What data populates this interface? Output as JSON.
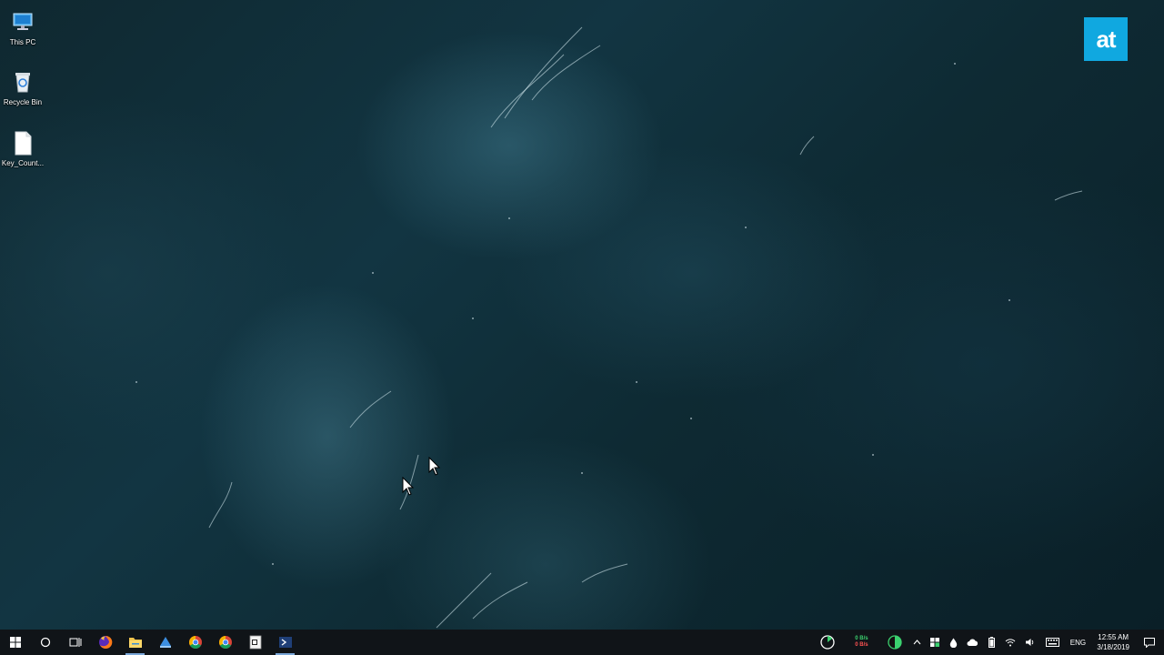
{
  "desktop": {
    "icons": [
      {
        "label": "This PC",
        "icon": "this-pc-icon"
      },
      {
        "label": "Recycle Bin",
        "icon": "recycle-bin-icon"
      },
      {
        "label": "Key_Count...",
        "icon": "text-file-icon"
      }
    ]
  },
  "watermark": {
    "text": "at",
    "color": "#10a8e0"
  },
  "taskbar": {
    "buttons": [
      {
        "name": "start",
        "icon": "windows-logo-icon"
      },
      {
        "name": "search",
        "icon": "cortana-search-icon"
      },
      {
        "name": "task-view",
        "icon": "task-view-icon"
      },
      {
        "name": "firefox",
        "icon": "firefox-icon"
      },
      {
        "name": "file-explorer",
        "icon": "folder-icon"
      },
      {
        "name": "app-blue",
        "icon": "blue-app-icon"
      },
      {
        "name": "chrome",
        "icon": "chrome-icon"
      },
      {
        "name": "chrome-2",
        "icon": "chrome-icon"
      },
      {
        "name": "notepad-app",
        "icon": "notepad-icon"
      },
      {
        "name": "powershell",
        "icon": "powershell-icon"
      }
    ],
    "tray": {
      "net_up": "0 B/s",
      "net_down": "0 B/s",
      "language": "ENG",
      "time": "12:55 AM",
      "date": "3/18/2019"
    }
  }
}
